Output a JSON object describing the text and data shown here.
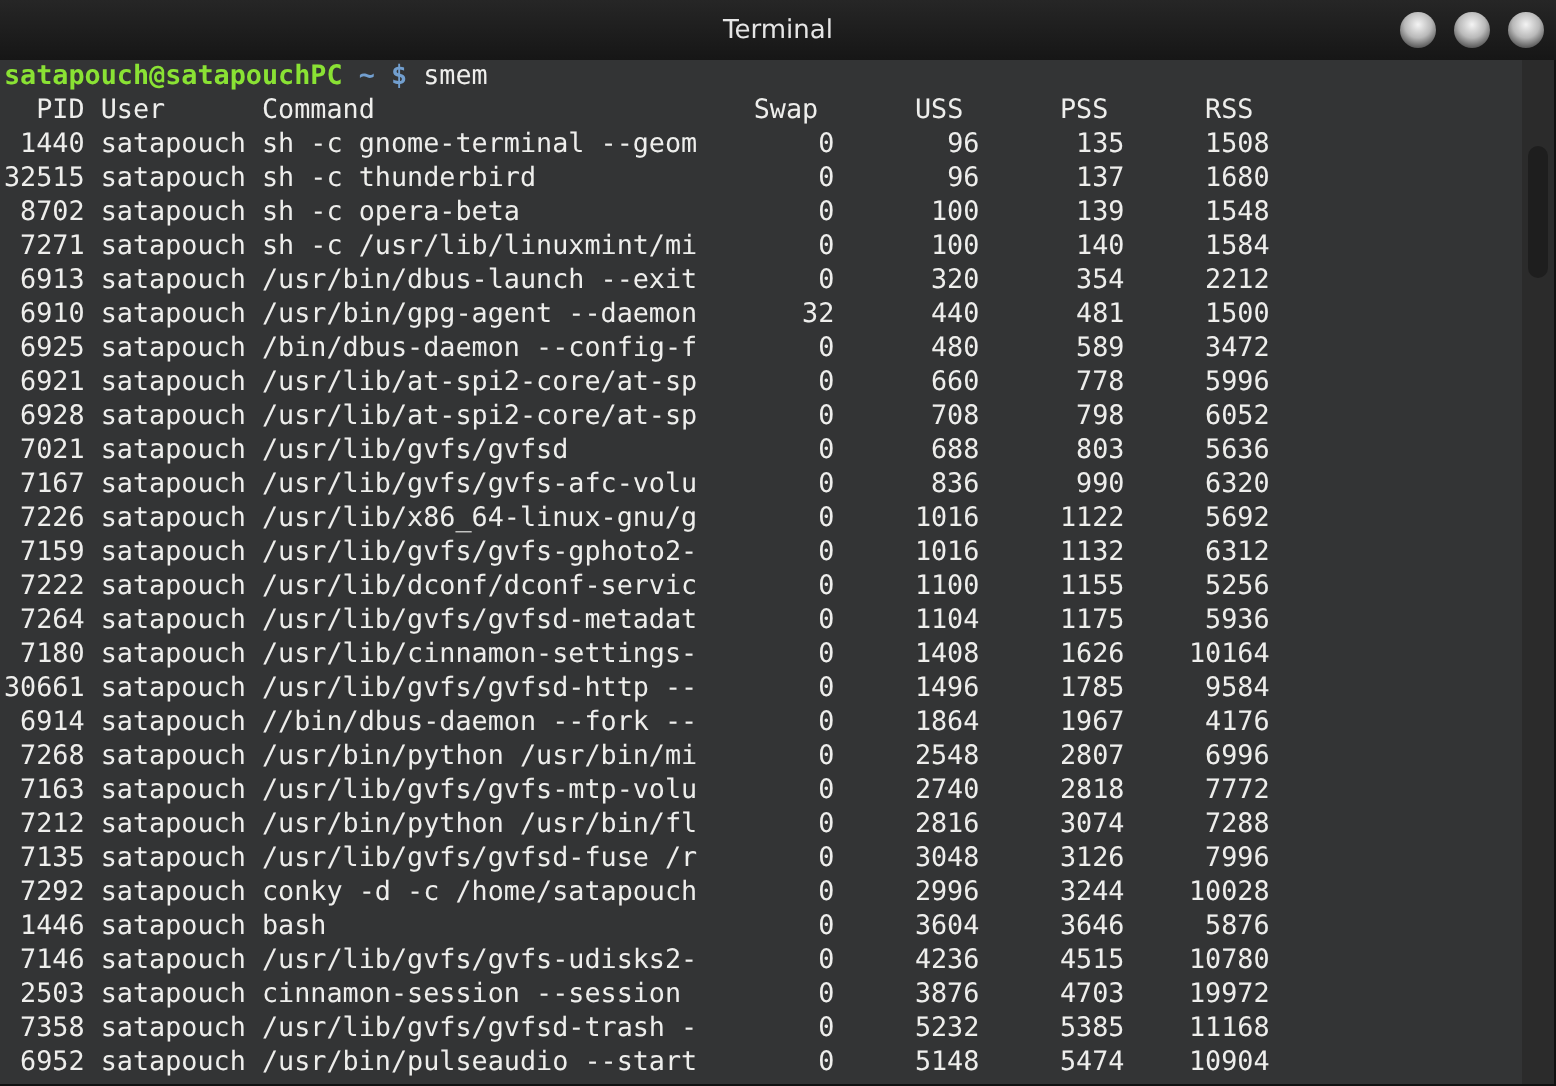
{
  "window": {
    "title": "Terminal"
  },
  "prompt": {
    "user_host": "satapouch@satapouchPC",
    "path": "~",
    "symbol": "$",
    "command": "smem"
  },
  "table": {
    "columns": [
      "PID",
      "User",
      "Command",
      "Swap",
      "USS",
      "PSS",
      "RSS"
    ],
    "rows": [
      [
        "1440",
        "satapouch",
        "sh -c gnome-terminal --geom",
        "0",
        "96",
        "135",
        "1508"
      ],
      [
        "32515",
        "satapouch",
        "sh -c thunderbird",
        "0",
        "96",
        "137",
        "1680"
      ],
      [
        "8702",
        "satapouch",
        "sh -c opera-beta",
        "0",
        "100",
        "139",
        "1548"
      ],
      [
        "7271",
        "satapouch",
        "sh -c /usr/lib/linuxmint/mi",
        "0",
        "100",
        "140",
        "1584"
      ],
      [
        "6913",
        "satapouch",
        "/usr/bin/dbus-launch --exit",
        "0",
        "320",
        "354",
        "2212"
      ],
      [
        "6910",
        "satapouch",
        "/usr/bin/gpg-agent --daemon",
        "32",
        "440",
        "481",
        "1500"
      ],
      [
        "6925",
        "satapouch",
        "/bin/dbus-daemon --config-f",
        "0",
        "480",
        "589",
        "3472"
      ],
      [
        "6921",
        "satapouch",
        "/usr/lib/at-spi2-core/at-sp",
        "0",
        "660",
        "778",
        "5996"
      ],
      [
        "6928",
        "satapouch",
        "/usr/lib/at-spi2-core/at-sp",
        "0",
        "708",
        "798",
        "6052"
      ],
      [
        "7021",
        "satapouch",
        "/usr/lib/gvfs/gvfsd",
        "0",
        "688",
        "803",
        "5636"
      ],
      [
        "7167",
        "satapouch",
        "/usr/lib/gvfs/gvfs-afc-volu",
        "0",
        "836",
        "990",
        "6320"
      ],
      [
        "7226",
        "satapouch",
        "/usr/lib/x86_64-linux-gnu/g",
        "0",
        "1016",
        "1122",
        "5692"
      ],
      [
        "7159",
        "satapouch",
        "/usr/lib/gvfs/gvfs-gphoto2-",
        "0",
        "1016",
        "1132",
        "6312"
      ],
      [
        "7222",
        "satapouch",
        "/usr/lib/dconf/dconf-servic",
        "0",
        "1100",
        "1155",
        "5256"
      ],
      [
        "7264",
        "satapouch",
        "/usr/lib/gvfs/gvfsd-metadat",
        "0",
        "1104",
        "1175",
        "5936"
      ],
      [
        "7180",
        "satapouch",
        "/usr/lib/cinnamon-settings-",
        "0",
        "1408",
        "1626",
        "10164"
      ],
      [
        "30661",
        "satapouch",
        "/usr/lib/gvfs/gvfsd-http --",
        "0",
        "1496",
        "1785",
        "9584"
      ],
      [
        "6914",
        "satapouch",
        "//bin/dbus-daemon --fork --",
        "0",
        "1864",
        "1967",
        "4176"
      ],
      [
        "7268",
        "satapouch",
        "/usr/bin/python /usr/bin/mi",
        "0",
        "2548",
        "2807",
        "6996"
      ],
      [
        "7163",
        "satapouch",
        "/usr/lib/gvfs/gvfs-mtp-volu",
        "0",
        "2740",
        "2818",
        "7772"
      ],
      [
        "7212",
        "satapouch",
        "/usr/bin/python /usr/bin/fl",
        "0",
        "2816",
        "3074",
        "7288"
      ],
      [
        "7135",
        "satapouch",
        "/usr/lib/gvfs/gvfsd-fuse /r",
        "0",
        "3048",
        "3126",
        "7996"
      ],
      [
        "7292",
        "satapouch",
        "conky -d -c /home/satapouch",
        "0",
        "2996",
        "3244",
        "10028"
      ],
      [
        "1446",
        "satapouch",
        "bash",
        "0",
        "3604",
        "3646",
        "5876"
      ],
      [
        "7146",
        "satapouch",
        "/usr/lib/gvfs/gvfs-udisks2-",
        "0",
        "4236",
        "4515",
        "10780"
      ],
      [
        "2503",
        "satapouch",
        "cinnamon-session --session",
        "0",
        "3876",
        "4703",
        "19972"
      ],
      [
        "7358",
        "satapouch",
        "/usr/lib/gvfs/gvfsd-trash -",
        "0",
        "5232",
        "5385",
        "11168"
      ],
      [
        "6952",
        "satapouch",
        "/usr/bin/pulseaudio --start",
        "0",
        "5148",
        "5474",
        "10904"
      ]
    ]
  }
}
